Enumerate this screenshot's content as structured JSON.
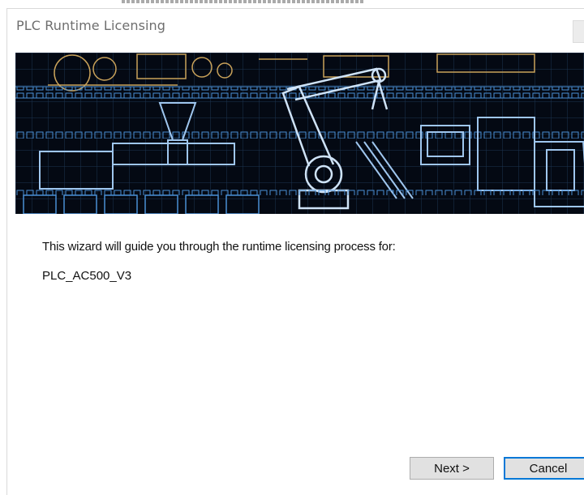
{
  "window": {
    "title": "PLC Runtime Licensing"
  },
  "wizard": {
    "intro_text": "This wizard will guide you through the runtime licensing process for:",
    "device_name": "PLC_AC500_V3"
  },
  "buttons": {
    "next_label": "Next >",
    "cancel_label": "Cancel"
  },
  "colors": {
    "banner_background": "#040913",
    "banner_line_blue": "#4a8fd4",
    "banner_line_gold": "#c9a25a",
    "focus_border": "#0078d7"
  }
}
